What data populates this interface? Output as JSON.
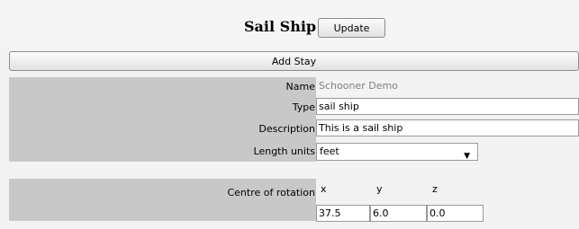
{
  "header": {
    "title": "Sail Ship",
    "update_label": "Update"
  },
  "add_stay_label": "Add Stay",
  "form": {
    "name_label": "Name",
    "name_value": "Schooner Demo",
    "type_label": "Type",
    "type_value": "sail ship",
    "description_label": "Description",
    "description_value": "This is a sail ship",
    "length_units_label": "Length units",
    "length_units_value": "feet"
  },
  "rotation": {
    "label": "Centre of rotation",
    "headers": [
      "x",
      "y",
      "z"
    ],
    "values": [
      "37.5",
      "6.0",
      "0.0"
    ]
  },
  "icons": {
    "dropdown": "chevron-down-icon"
  }
}
